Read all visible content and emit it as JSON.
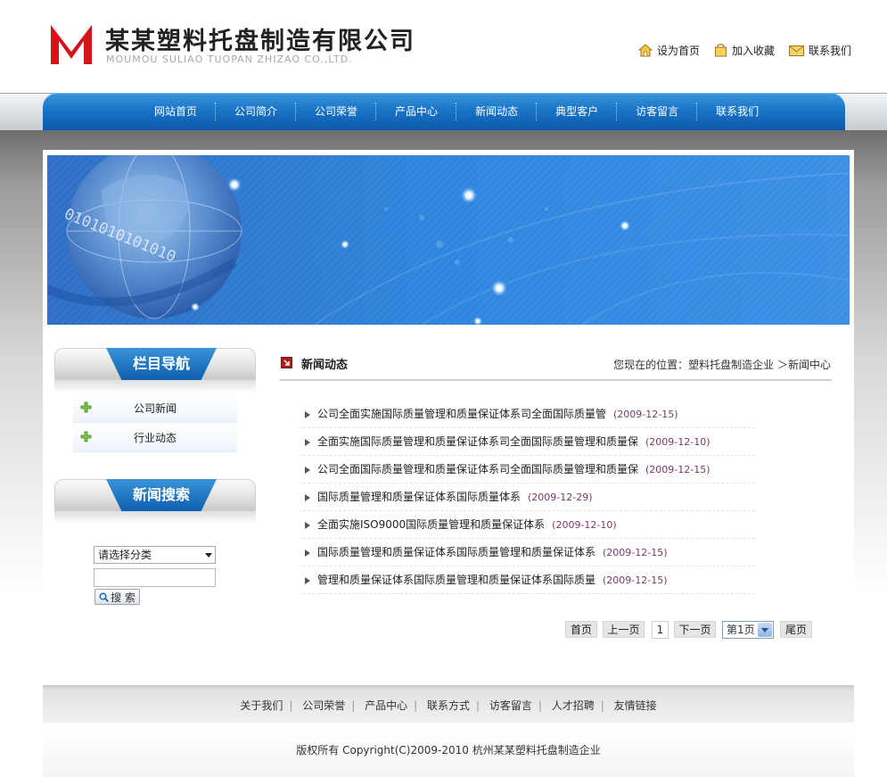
{
  "header": {
    "brand_cn": "某某塑料托盘制造有限公司",
    "brand_en": "MOUMOU SULIAO TUOPAN ZHIZAO CO.,LTD.",
    "links": [
      {
        "label": "设为首页",
        "icon": "home-icon"
      },
      {
        "label": "加入收藏",
        "icon": "bookmark-icon"
      },
      {
        "label": "联系我们",
        "icon": "mail-icon"
      }
    ]
  },
  "nav": {
    "items": [
      "网站首页",
      "公司简介",
      "公司荣誉",
      "产品中心",
      "新闻动态",
      "典型客户",
      "访客留言",
      "联系我们"
    ]
  },
  "sidebar": {
    "nav_title": "栏目导航",
    "categories": [
      "公司新闻",
      "行业动态"
    ],
    "search_title": "新闻搜索",
    "select_value": "请选择分类",
    "keyword_value": "",
    "search_button": "搜 索"
  },
  "main": {
    "title": "新闻动态",
    "breadcrumb": "您现在的位置：塑料托盘制造企业 ＞新闻中心",
    "news": [
      {
        "title": "公司全面实施国际质量管理和质量保证体系司全面国际质量管",
        "date": "(2009-12-15)"
      },
      {
        "title": "全面实施国际质量管理和质量保证体系司全面国际质量管理和质量保",
        "date": "(2009-12-10)"
      },
      {
        "title": "公司全面国际质量管理和质量保证体系司全面国际质量管理和质量保",
        "date": "(2009-12-15)"
      },
      {
        "title": "国际质量管理和质量保证体系国际质量体系",
        "date": "(2009-12-29)"
      },
      {
        "title": "全面实施ISO9000国际质量管理和质量保证体系",
        "date": "(2009-12-10)"
      },
      {
        "title": "国际质量管理和质量保证体系国际质量管理和质量保证体系",
        "date": "(2009-12-15)"
      },
      {
        "title": "管理和质量保证体系国际质量管理和质量保证体系国际质量",
        "date": "(2009-12-15)"
      }
    ],
    "pager": {
      "first": "首页",
      "prev": "上一页",
      "current": "1",
      "next": "下一页",
      "select": "第1页",
      "last": "尾页"
    }
  },
  "footer": {
    "links": [
      "关于我们",
      "公司荣誉",
      "产品中心",
      "联系方式",
      "访客留言",
      "人才招聘",
      "友情链接"
    ],
    "separator": "|",
    "copyright": "版权所有  Copyright(C)2009-2010 杭州某某塑料托盘制造企业"
  },
  "colors": {
    "nav_blue": "#1a74c7",
    "logo_red": "#d8141b",
    "date_purple": "#7a3a6a"
  }
}
